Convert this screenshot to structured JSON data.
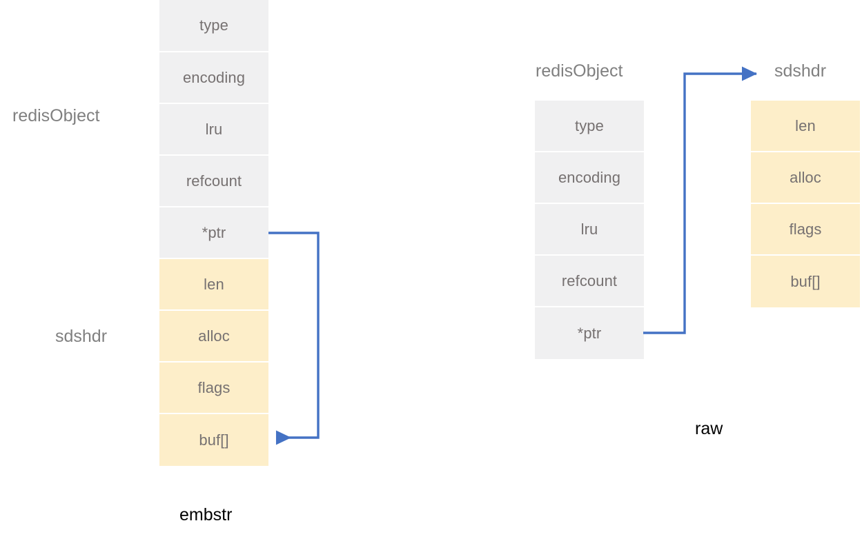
{
  "diagram": {
    "title_left": "redisObject",
    "title_left_sds": "sdshdr",
    "caption_embstr": "embstr",
    "caption_raw": "raw",
    "title_right_redis": "redisObject",
    "title_right_sds": "sdshdr",
    "colors": {
      "redis_field_bg": "#f0f0f1",
      "sds_field_bg": "#fdeec9",
      "field_text": "#767171",
      "label_text": "#808080",
      "caption_text": "#000000",
      "arrow": "#4472c4",
      "background": "#ffffff"
    }
  },
  "embstr_block": {
    "name": "embstr",
    "redis_fields": [
      {
        "label": "type"
      },
      {
        "label": "encoding"
      },
      {
        "label": "lru"
      },
      {
        "label": "refcount"
      },
      {
        "label": "*ptr"
      }
    ],
    "sds_fields": [
      {
        "label": "len"
      },
      {
        "label": "alloc"
      },
      {
        "label": "flags"
      },
      {
        "label": "buf[]"
      }
    ]
  },
  "raw_block": {
    "name": "raw",
    "redis_fields": [
      {
        "label": "type"
      },
      {
        "label": "encoding"
      },
      {
        "label": "lru"
      },
      {
        "label": "refcount"
      },
      {
        "label": "*ptr"
      }
    ],
    "sds_fields": [
      {
        "label": "len"
      },
      {
        "label": "alloc"
      },
      {
        "label": "flags"
      },
      {
        "label": "buf[]"
      }
    ]
  }
}
